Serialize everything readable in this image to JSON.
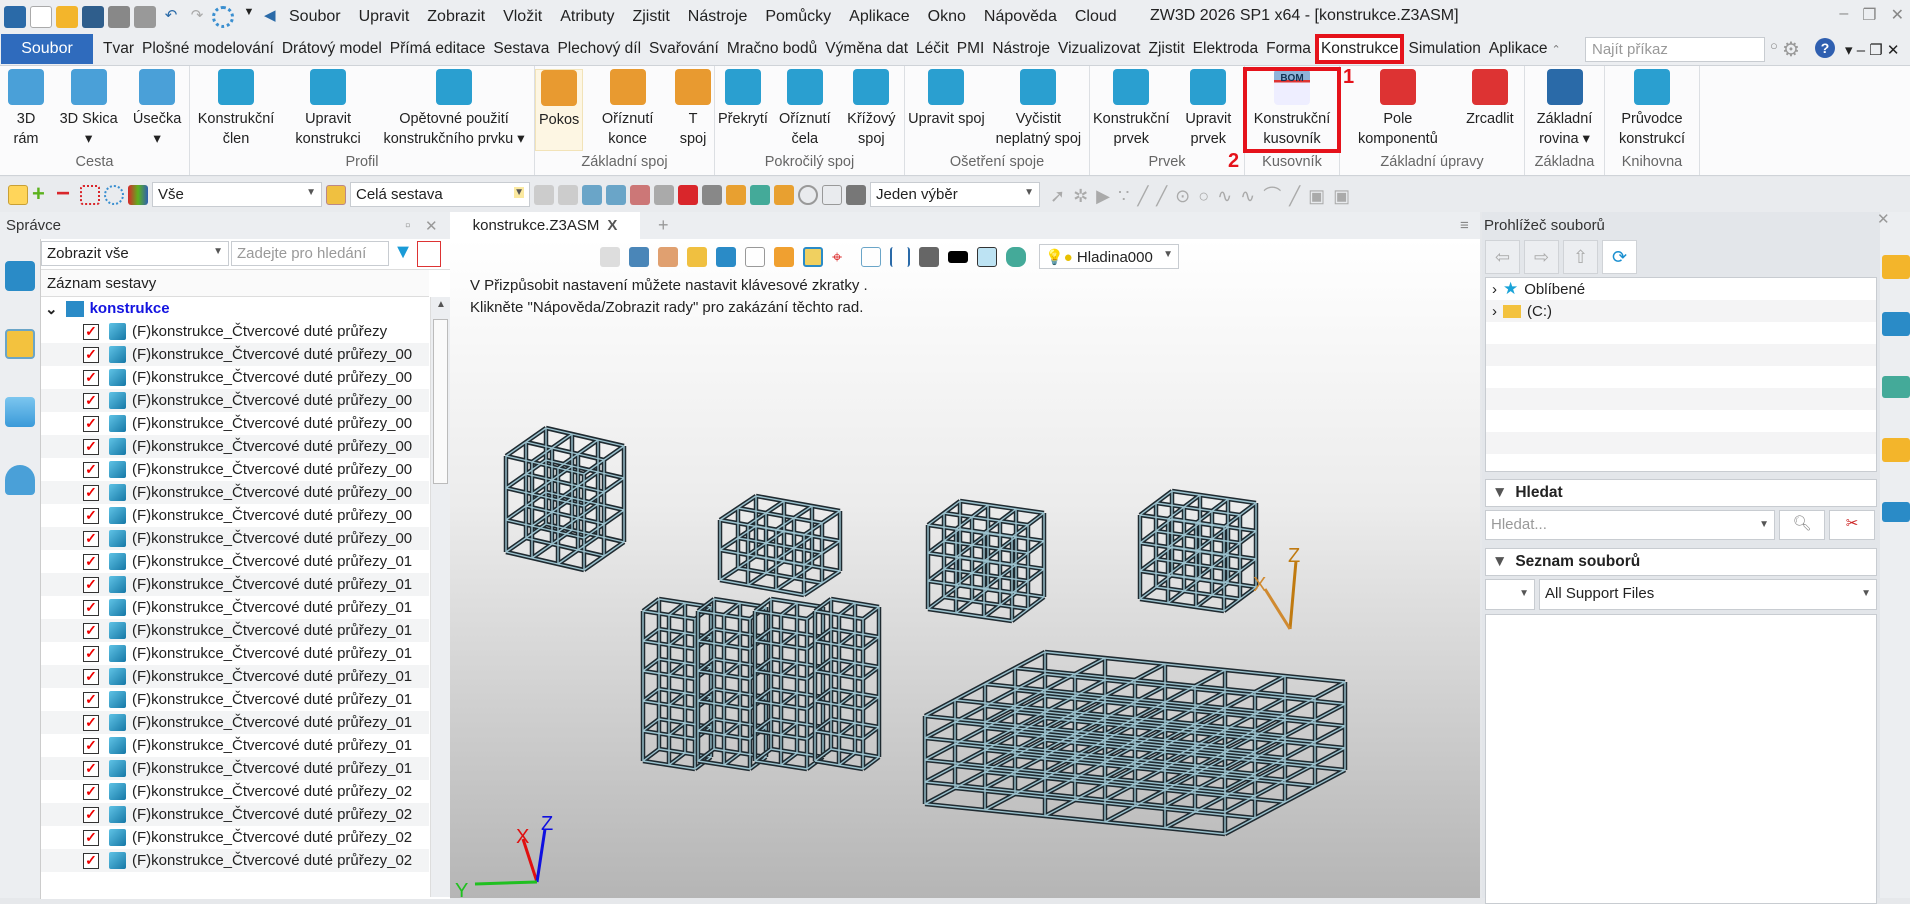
{
  "titlebar": {
    "menu": [
      "Soubor",
      "Upravit",
      "Zobrazit",
      "Vložit",
      "Atributy",
      "Zjistit",
      "Nástroje",
      "Pomůcky",
      "Aplikace",
      "Okno",
      "Nápověda",
      "Cloud"
    ],
    "app_title": "ZW3D 2026 SP1 x64  - [konstrukce.Z3ASM]"
  },
  "ribbon_tabs": {
    "file": "Soubor",
    "tabs": [
      "Tvar",
      "Plošné modelování",
      "Drátový model",
      "Přímá editace",
      "Sestava",
      "Plechový díl",
      "Svařování",
      "Mračno bodů",
      "Výměna dat",
      "Léčit",
      "PMI",
      "Nástroje",
      "Vizualizovat",
      "Zjistit",
      "Elektroda",
      "Forma",
      "Konstrukce",
      "Simulation",
      "Aplikace"
    ],
    "active": "Konstrukce",
    "find_placeholder": "Najít příkaz"
  },
  "ribbon": {
    "groups": [
      {
        "label": "Cesta",
        "buttons": [
          "3D rám",
          "3D Skica ▾",
          "Úsečka ▾"
        ]
      },
      {
        "label": "Profil",
        "buttons": [
          "Konstrukční člen",
          "Upravit konstrukci",
          "Opětovné použití konstrukčního prvku ▾"
        ]
      },
      {
        "label": "Základní spoj",
        "buttons": [
          "Pokos",
          "Oříznutí konce",
          "T spoj"
        ]
      },
      {
        "label": "Pokročilý spoj",
        "buttons": [
          "Překrytí",
          "Oříznutí čela",
          "Křížový spoj"
        ]
      },
      {
        "label": "Ošetření spoje",
        "buttons": [
          "Upravit spoj",
          "Vyčistit neplatný spoj"
        ]
      },
      {
        "label": "Prvek",
        "buttons": [
          "Konstrukční prvek",
          "Upravit prvek"
        ]
      },
      {
        "label": "Kusovník",
        "buttons": [
          "Konstrukční kusovník"
        ]
      },
      {
        "label": "Základní úpravy",
        "buttons": [
          "Pole komponentů",
          "Zrcadlit"
        ]
      },
      {
        "label": "Základna",
        "buttons": [
          "Základní rovina ▾"
        ]
      },
      {
        "label": "Knihovna",
        "buttons": [
          "Průvodce konstrukcí"
        ]
      }
    ],
    "bom_icon_text": "BOM",
    "annotations": [
      "1",
      "2"
    ]
  },
  "toolbar": {
    "filter": "Vše",
    "scope": "Celá sestava",
    "selection_mode": "Jeden výběr"
  },
  "manager": {
    "title": "Správce",
    "show_filter": "Zobrazit vše",
    "search_placeholder": "Zadejte pro hledání",
    "column": "Záznam sestavy",
    "root": "konstrukce",
    "items": [
      "(F)konstrukce_Čtvercové duté průřezy",
      "(F)konstrukce_Čtvercové duté průřezy_00",
      "(F)konstrukce_Čtvercové duté průřezy_00",
      "(F)konstrukce_Čtvercové duté průřezy_00",
      "(F)konstrukce_Čtvercové duté průřezy_00",
      "(F)konstrukce_Čtvercové duté průřezy_00",
      "(F)konstrukce_Čtvercové duté průřezy_00",
      "(F)konstrukce_Čtvercové duté průřezy_00",
      "(F)konstrukce_Čtvercové duté průřezy_00",
      "(F)konstrukce_Čtvercové duté průřezy_00",
      "(F)konstrukce_Čtvercové duté průřezy_01",
      "(F)konstrukce_Čtvercové duté průřezy_01",
      "(F)konstrukce_Čtvercové duté průřezy_01",
      "(F)konstrukce_Čtvercové duté průřezy_01",
      "(F)konstrukce_Čtvercové duté průřezy_01",
      "(F)konstrukce_Čtvercové duté průřezy_01",
      "(F)konstrukce_Čtvercové duté průřezy_01",
      "(F)konstrukce_Čtvercové duté průřezy_01",
      "(F)konstrukce_Čtvercové duté průřezy_01",
      "(F)konstrukce_Čtvercové duté průřezy_01",
      "(F)konstrukce_Čtvercové duté průřezy_02",
      "(F)konstrukce_Čtvercové duté průřezy_02",
      "(F)konstrukce_Čtvercové duté průřezy_02",
      "(F)konstrukce_Čtvercové duté průřezy_02"
    ]
  },
  "viewport": {
    "tab": "konstrukce.Z3ASM",
    "tab_close": "X",
    "tab_add": "+",
    "layer": "Hladina000",
    "hint_line1": "V Přizpůsobit nastavení můžete nastavit klávesové zkratky .",
    "hint_line2": "Klikněte \"Nápověda/Zobrazit rady\" pro zakázání těchto rad.",
    "axes": {
      "x": "X",
      "y": "Y",
      "z": "Z"
    }
  },
  "file_browser": {
    "title": "Prohlížeč souborů",
    "tree": [
      "Oblíbené",
      "(C:)"
    ],
    "search_header": "Hledat",
    "search_placeholder": "Hledat...",
    "list_header": "Seznam souborů",
    "file_type": "All Support Files"
  },
  "colors": {
    "accent": "#2f6bbd",
    "highlight": "#e5121b",
    "steel": "#2d3a40"
  }
}
